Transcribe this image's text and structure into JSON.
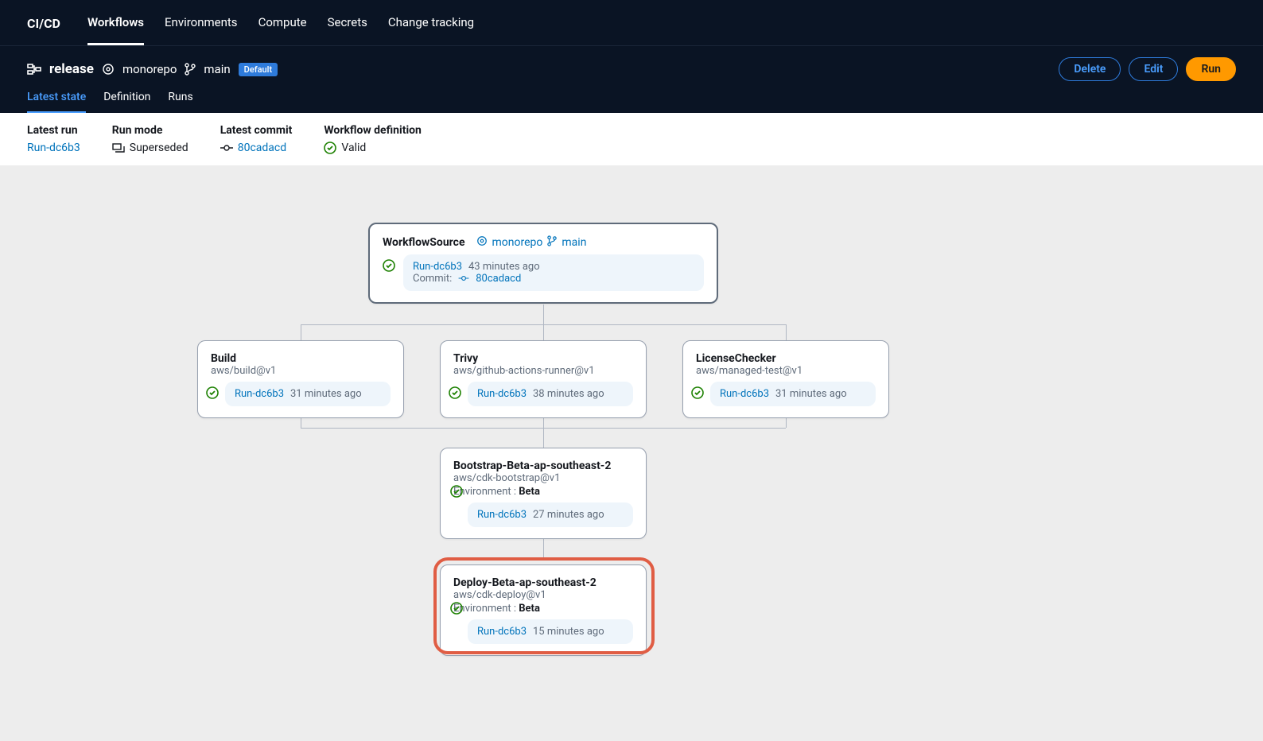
{
  "nav": {
    "brand": "CI/CD",
    "items": [
      "Workflows",
      "Environments",
      "Compute",
      "Secrets",
      "Change tracking"
    ],
    "active": 0
  },
  "header": {
    "title": "release",
    "repo": "monorepo",
    "branch": "main",
    "badge": "Default",
    "actions": {
      "delete": "Delete",
      "edit": "Edit",
      "run": "Run"
    },
    "tabs": [
      "Latest state",
      "Definition",
      "Runs"
    ],
    "active_tab": 0
  },
  "summary": {
    "latest_run": {
      "label": "Latest run",
      "value": "Run-dc6b3"
    },
    "run_mode": {
      "label": "Run mode",
      "value": "Superseded"
    },
    "latest_commit": {
      "label": "Latest commit",
      "value": "80cadacd"
    },
    "workflow_def": {
      "label": "Workflow definition",
      "value": "Valid"
    }
  },
  "source_node": {
    "title": "WorkflowSource",
    "repo": "monorepo",
    "branch": "main",
    "run": "Run-dc6b3",
    "age": "43 minutes ago",
    "commit_label": "Commit:",
    "commit": "80cadacd"
  },
  "actions_row": [
    {
      "title": "Build",
      "impl": "aws/build@v1",
      "run": "Run-dc6b3",
      "age": "31 minutes ago"
    },
    {
      "title": "Trivy",
      "impl": "aws/github-actions-runner@v1",
      "run": "Run-dc6b3",
      "age": "38 minutes ago"
    },
    {
      "title": "LicenseChecker",
      "impl": "aws/managed-test@v1",
      "run": "Run-dc6b3",
      "age": "31 minutes ago"
    }
  ],
  "bootstrap": {
    "title": "Bootstrap-Beta-ap-southeast-2",
    "impl": "aws/cdk-bootstrap@v1",
    "env_label": "Environment :",
    "env": "Beta",
    "run": "Run-dc6b3",
    "age": "27 minutes ago"
  },
  "deploy": {
    "title": "Deploy-Beta-ap-southeast-2",
    "impl": "aws/cdk-deploy@v1",
    "env_label": "Environment :",
    "env": "Beta",
    "run": "Run-dc6b3",
    "age": "15 minutes ago"
  }
}
